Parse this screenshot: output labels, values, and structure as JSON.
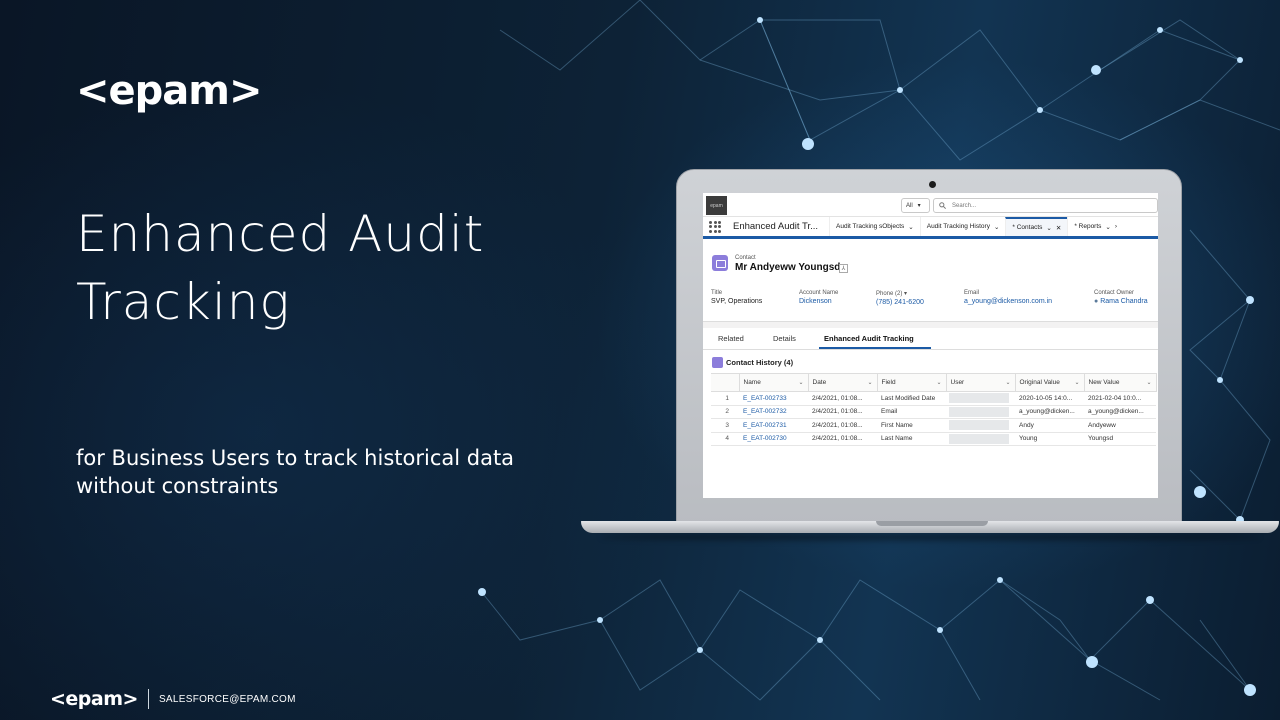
{
  "slide": {
    "logo": "<epam>",
    "headline_line1": "Enhanced Audit",
    "headline_line2": "Tracking",
    "subline_line1": "for Business Users to track historical data",
    "subline_line2": "without constraints",
    "footer_logo": "<epam>",
    "footer_email": "SALESFORCE@EPAM.COM"
  },
  "colors": {
    "background": "#0b1a2b",
    "accent": "#1b5aa5",
    "contact_icon": "#8c7ddb"
  },
  "app": {
    "logo_text": "epam",
    "search_scope": "All",
    "search_placeholder": "Search...",
    "app_name": "Enhanced Audit Tr...",
    "nav_tabs": [
      {
        "label": "Audit Tracking sObjects"
      },
      {
        "label": "Audit Tracking History"
      },
      {
        "label": "* Contacts"
      },
      {
        "label": "* Reports"
      }
    ],
    "record": {
      "object_type": "Contact",
      "name": "Mr Andyeww Youngsd",
      "fields": [
        {
          "label": "Title",
          "value": "SVP, Operations"
        },
        {
          "label": "Account Name",
          "value": "Dickenson"
        },
        {
          "label": "Phone (2)",
          "value": "(785) 241-6200"
        },
        {
          "label": "Email",
          "value": "a_young@dickenson.com.in"
        },
        {
          "label": "Contact Owner",
          "value": "Rama Chandra"
        }
      ]
    },
    "tabs": [
      "Related",
      "Details",
      "Enhanced Audit Tracking"
    ],
    "history": {
      "title": "Contact History (4)",
      "columns": [
        "Name",
        "Date",
        "Field",
        "User",
        "Original Value",
        "New Value"
      ],
      "rows": [
        {
          "n": "1",
          "name": "E_EAT-002733",
          "date": "2/4/2021, 01:08...",
          "field": "Last Modified Date",
          "orig": "2020-10-05 14:0...",
          "new": "2021-02-04 10:0..."
        },
        {
          "n": "2",
          "name": "E_EAT-002732",
          "date": "2/4/2021, 01:08...",
          "field": "Email",
          "orig": "a_young@dicken...",
          "new": "a_young@dicken..."
        },
        {
          "n": "3",
          "name": "E_EAT-002731",
          "date": "2/4/2021, 01:08...",
          "field": "First Name",
          "orig": "Andy",
          "new": "Andyeww"
        },
        {
          "n": "4",
          "name": "E_EAT-002730",
          "date": "2/4/2021, 01:08...",
          "field": "Last Name",
          "orig": "Young",
          "new": "Youngsd"
        }
      ]
    }
  }
}
